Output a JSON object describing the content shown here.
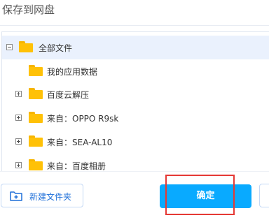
{
  "dialog": {
    "title": "保存到网盘"
  },
  "tree": {
    "root": {
      "label": "全部文件",
      "expander": "minus"
    },
    "items": [
      {
        "label": "我的应用数据",
        "expander": "none"
      },
      {
        "label": "百度云解压",
        "expander": "plus"
      },
      {
        "label": "来自：OPPO R9sk",
        "expander": "plus"
      },
      {
        "label": "来自：SEA-AL10",
        "expander": "plus"
      },
      {
        "label": "来自：百度相册",
        "expander": "plus"
      }
    ]
  },
  "footer": {
    "new_folder_label": "新建文件夹",
    "confirm_label": "确定"
  },
  "colors": {
    "accent": "#09aaff",
    "link": "#1e6fd9",
    "folder": "#ffc107",
    "highlight": "#e53935"
  },
  "icons": {
    "folder": "folder-icon",
    "new_folder": "new-folder-icon"
  }
}
